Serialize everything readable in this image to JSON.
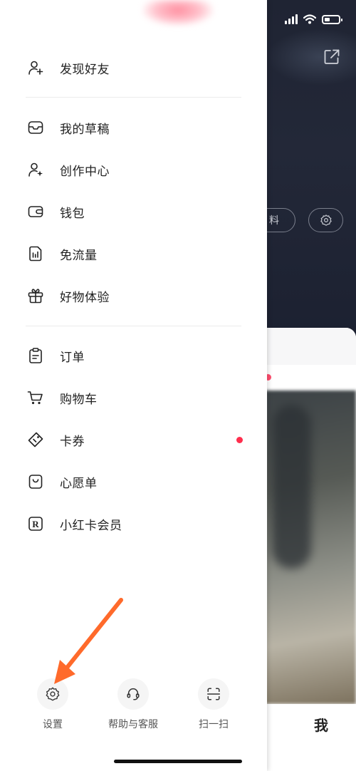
{
  "status_bar": {
    "icons": [
      "signal-icon",
      "wifi-icon",
      "battery-icon"
    ]
  },
  "background": {
    "edit_profile_partial": "料",
    "tab_me": "我"
  },
  "drawer": {
    "section1": [
      {
        "label": "发现好友",
        "icon": "add-friend-icon"
      }
    ],
    "section2": [
      {
        "label": "我的草稿",
        "icon": "inbox-tray-icon"
      },
      {
        "label": "创作中心",
        "icon": "creator-icon"
      },
      {
        "label": "钱包",
        "icon": "wallet-icon"
      },
      {
        "label": "免流量",
        "icon": "data-card-icon"
      },
      {
        "label": "好物体验",
        "icon": "gift-icon"
      }
    ],
    "section3": [
      {
        "label": "订单",
        "icon": "clipboard-icon"
      },
      {
        "label": "购物车",
        "icon": "cart-icon"
      },
      {
        "label": "卡券",
        "icon": "coupon-tag-icon",
        "badge_dot": true
      },
      {
        "label": "心愿单",
        "icon": "wishlist-bag-icon"
      },
      {
        "label": "小红卡会员",
        "icon": "r-badge-icon"
      }
    ],
    "bottom_actions": [
      {
        "label": "设置",
        "icon": "gear-icon"
      },
      {
        "label": "帮助与客服",
        "icon": "headset-icon"
      },
      {
        "label": "扫一扫",
        "icon": "scan-icon"
      }
    ]
  },
  "colors": {
    "badge_dot": "#ff2e4d",
    "annotation_arrow": "#ff6a2b"
  }
}
